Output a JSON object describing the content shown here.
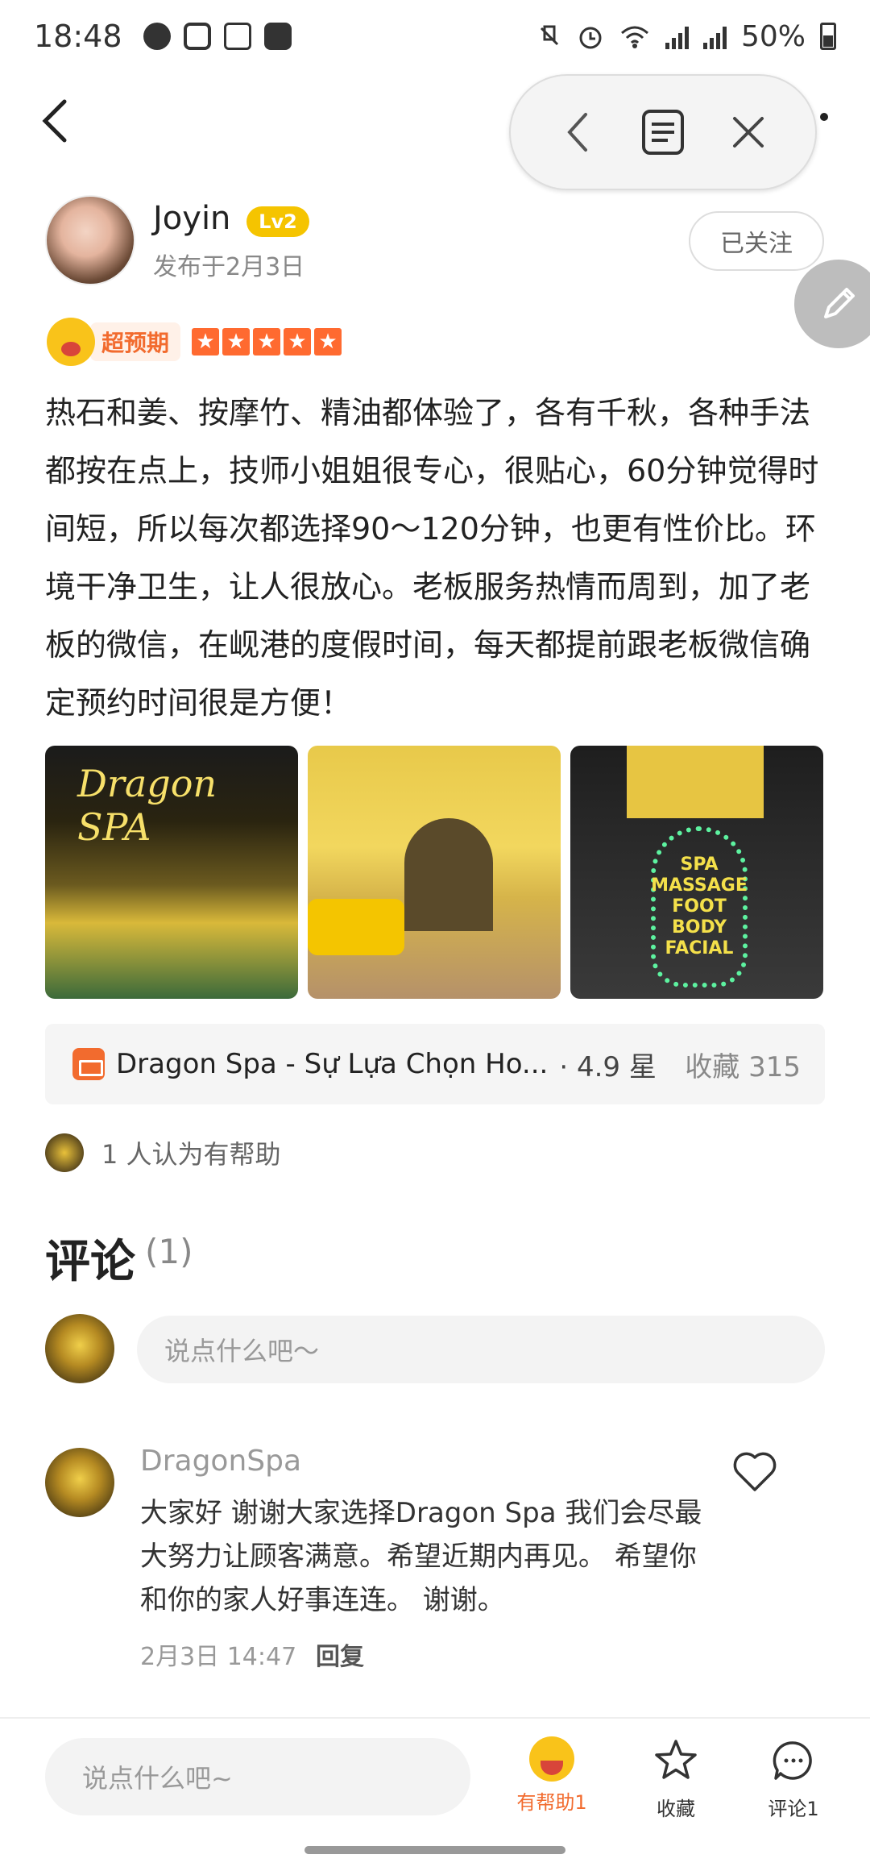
{
  "status_bar": {
    "time": "18:48",
    "battery": "50%"
  },
  "author": {
    "name": "Joyin",
    "level": "Lv2",
    "post_date": "发布于2月3日",
    "follow_label": "已关注"
  },
  "rating": {
    "tag": "超预期",
    "stars": 5
  },
  "review": {
    "text": "热石和姜、按摩竹、精油都体验了，各有千秋，各种手法都按在点上，技师小姐姐很专心，很贴心，60分钟觉得时间短，所以每次都选择90～120分钟，也更有性价比。环境干净卫生，让人很放心。老板服务热情而周到，加了老板的微信，在岘港的度假时间，每天都提前跟老板微信确定预约时间很是方便！"
  },
  "photos": {
    "photo1_sign": "Dragon SPA",
    "photo3_sign": "SPA MASSAGE FOOT BODY FACIAL"
  },
  "shop": {
    "name": "Dragon Spa - Sự Lựa Chọn Ho...",
    "rating": "· 4.9 星",
    "favorites": "收藏 315"
  },
  "helpful": {
    "text": "1 人认为有帮助"
  },
  "comments": {
    "title": "评论",
    "count": "(1)",
    "input_placeholder": "说点什么吧～",
    "items": [
      {
        "user": "DragonSpa",
        "body": "大家好 谢谢大家选择Dragon Spa 我们会尽最大努力让顾客满意。希望近期内再见。 希望你和你的家人好事连连。 谢谢。",
        "date": "2月3日  14:47",
        "reply_label": "回复"
      }
    ]
  },
  "bottom_bar": {
    "input_placeholder": "说点什么吧~",
    "helpful_label": "有帮助1",
    "collect_label": "收藏",
    "comment_label": "评论1"
  },
  "colors": {
    "accent": "#f26b2e",
    "badge": "#f5c400"
  }
}
